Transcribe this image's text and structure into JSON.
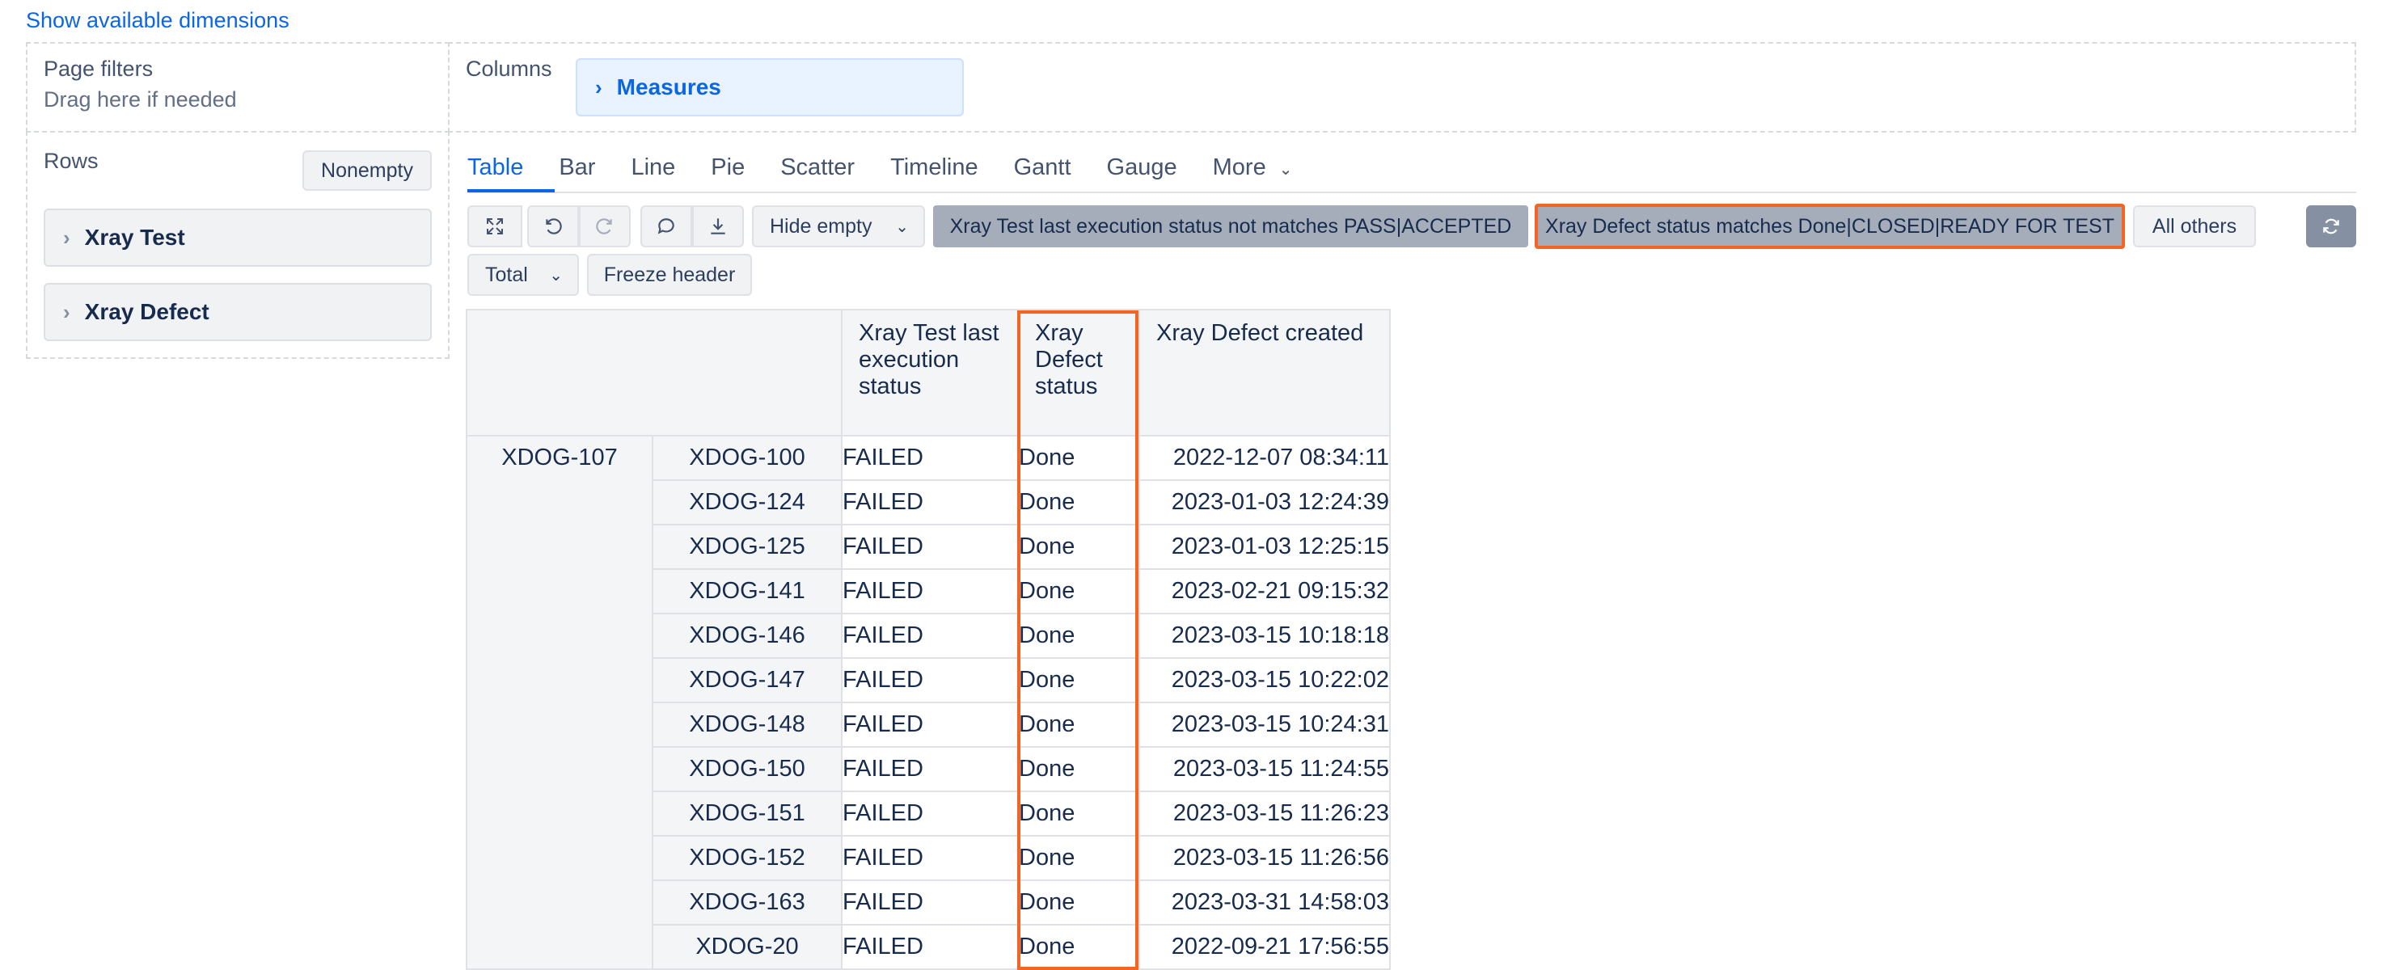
{
  "show_dimensions_link": "Show available dimensions",
  "page_filters": {
    "title": "Page filters",
    "hint": "Drag here if needed"
  },
  "columns": {
    "title": "Columns",
    "items": [
      "Measures"
    ]
  },
  "rows": {
    "title": "Rows",
    "nonempty_label": "Nonempty",
    "items": [
      "Xray Test",
      "Xray Defect"
    ]
  },
  "tabs": [
    "Table",
    "Bar",
    "Line",
    "Pie",
    "Scatter",
    "Timeline",
    "Gantt",
    "Gauge"
  ],
  "more_label": "More",
  "active_tab": "Table",
  "toolbar": {
    "hide_empty_label": "Hide empty",
    "filter_1": "Xray Test last execution status not matches PASS|ACCEPTED",
    "filter_2": "Xray Defect status matches Done|CLOSED|READY FOR TEST",
    "all_others_label": "All others",
    "total_label": "Total",
    "freeze_header_label": "Freeze header"
  },
  "table": {
    "headers": [
      "Xray Test last execution status",
      "Xray Defect status",
      "Xray Defect created"
    ],
    "group": "XDOG-107",
    "rows": [
      {
        "id": "XDOG-100",
        "exec": "FAILED",
        "status": "Done",
        "created": "2022-12-07 08:34:11"
      },
      {
        "id": "XDOG-124",
        "exec": "FAILED",
        "status": "Done",
        "created": "2023-01-03 12:24:39"
      },
      {
        "id": "XDOG-125",
        "exec": "FAILED",
        "status": "Done",
        "created": "2023-01-03 12:25:15"
      },
      {
        "id": "XDOG-141",
        "exec": "FAILED",
        "status": "Done",
        "created": "2023-02-21 09:15:32"
      },
      {
        "id": "XDOG-146",
        "exec": "FAILED",
        "status": "Done",
        "created": "2023-03-15 10:18:18"
      },
      {
        "id": "XDOG-147",
        "exec": "FAILED",
        "status": "Done",
        "created": "2023-03-15 10:22:02"
      },
      {
        "id": "XDOG-148",
        "exec": "FAILED",
        "status": "Done",
        "created": "2023-03-15 10:24:31"
      },
      {
        "id": "XDOG-150",
        "exec": "FAILED",
        "status": "Done",
        "created": "2023-03-15 11:24:55"
      },
      {
        "id": "XDOG-151",
        "exec": "FAILED",
        "status": "Done",
        "created": "2023-03-15 11:26:23"
      },
      {
        "id": "XDOG-152",
        "exec": "FAILED",
        "status": "Done",
        "created": "2023-03-15 11:26:56"
      },
      {
        "id": "XDOG-163",
        "exec": "FAILED",
        "status": "Done",
        "created": "2023-03-31 14:58:03"
      },
      {
        "id": "XDOG-20",
        "exec": "FAILED",
        "status": "Done",
        "created": "2022-09-21 17:56:55"
      }
    ]
  },
  "colors": {
    "accent": "#0c66e4",
    "highlight": "#f26522",
    "chip_bg": "#a5adba"
  }
}
